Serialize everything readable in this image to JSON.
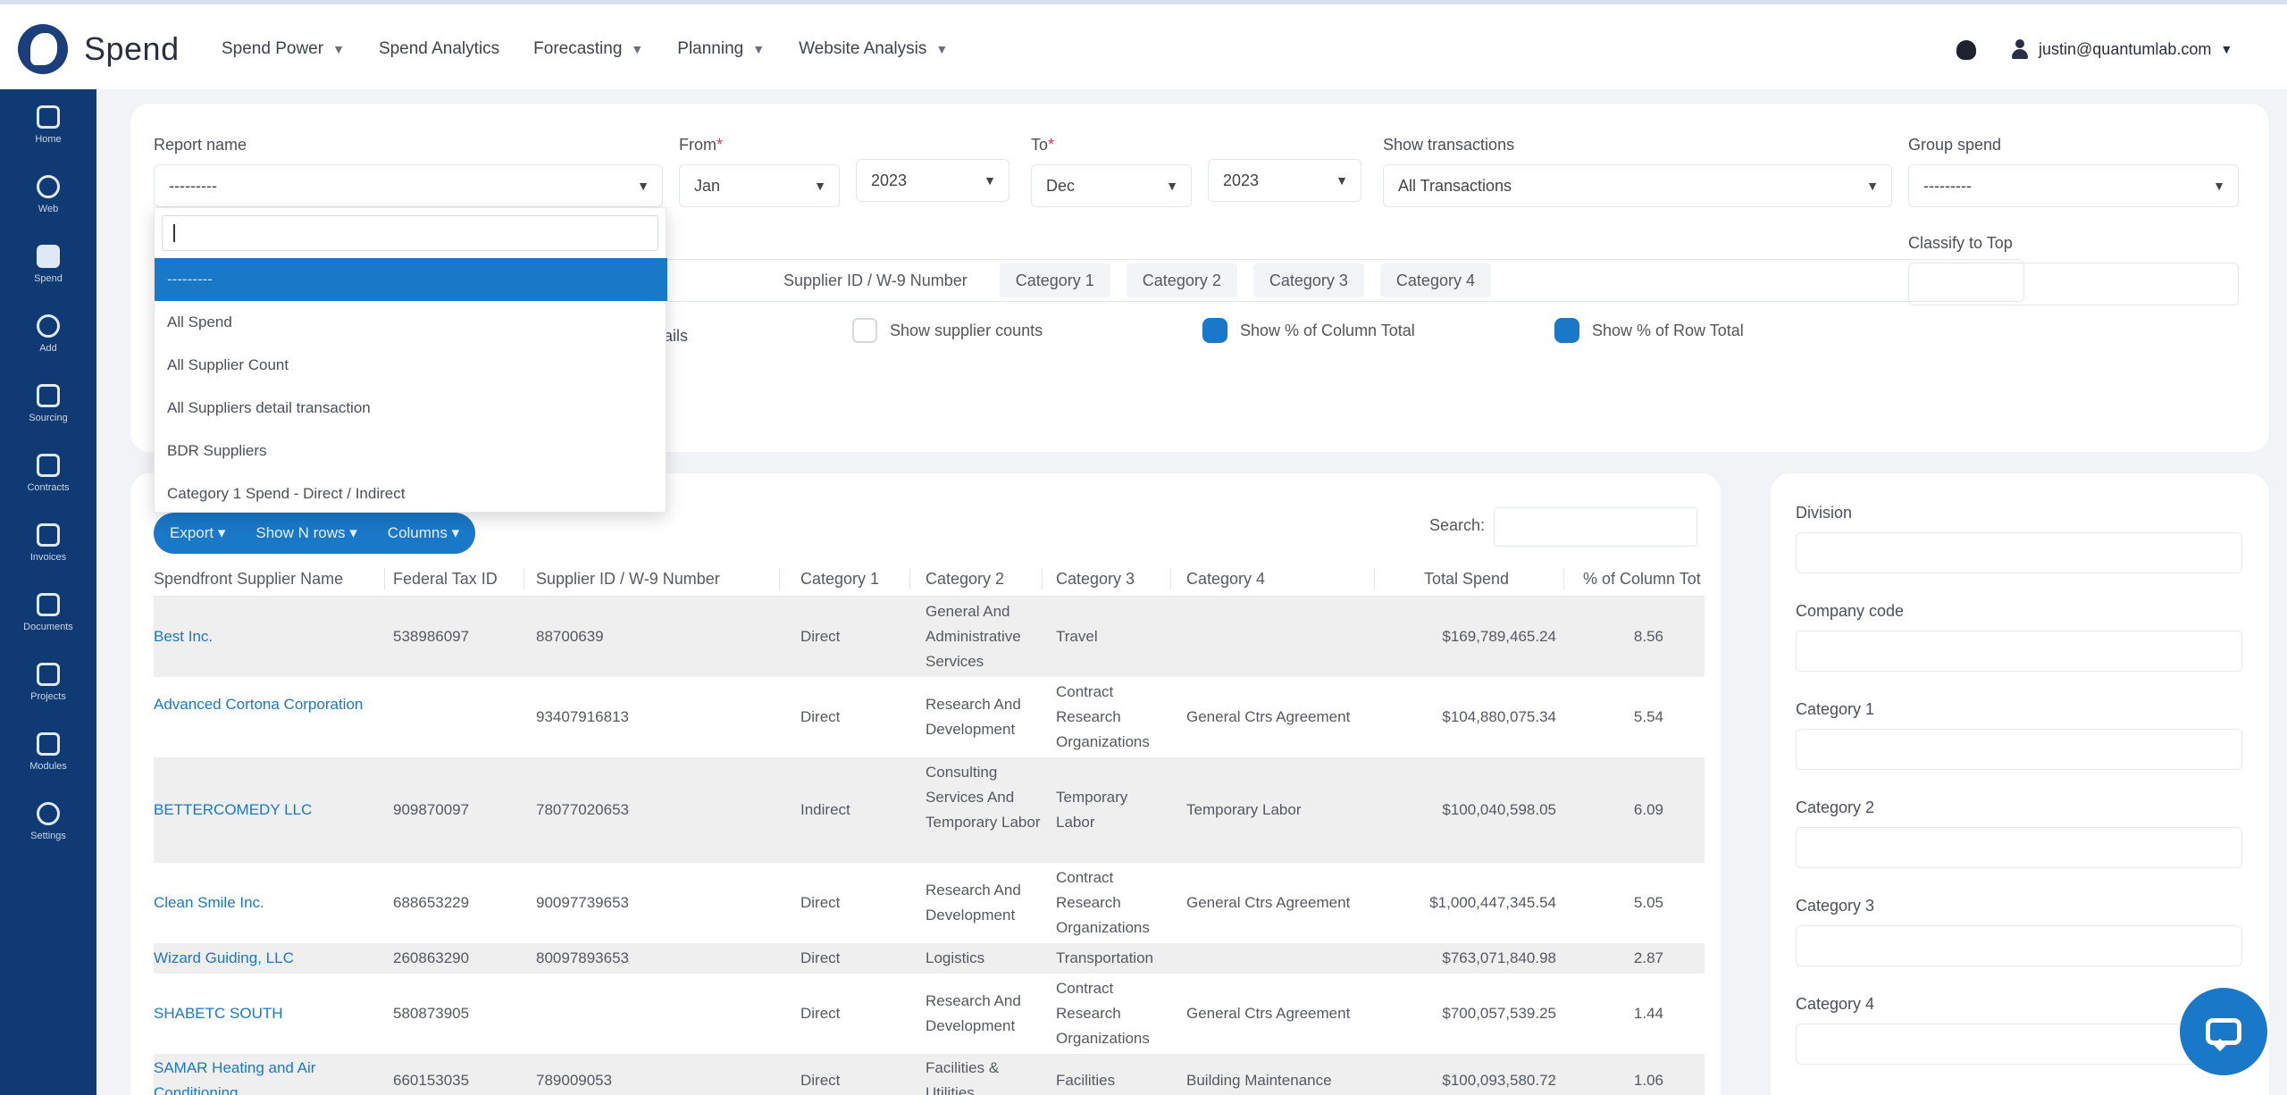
{
  "app": {
    "brand_name": "Spend"
  },
  "nav": {
    "items": [
      {
        "label": "Spend Power",
        "caret": true
      },
      {
        "label": "Spend Analytics",
        "caret": false
      },
      {
        "label": "Forecasting",
        "caret": true
      },
      {
        "label": "Planning",
        "caret": true
      },
      {
        "label": "Website Analysis",
        "caret": true
      }
    ],
    "user_email": "justin@quantumlab.com"
  },
  "sidebar": {
    "items": [
      {
        "label": "Home",
        "icon": "home-icon"
      },
      {
        "label": "Web",
        "icon": "globe-icon"
      },
      {
        "label": "Spend",
        "icon": "spend-icon",
        "active": true
      },
      {
        "label": "Add",
        "icon": "add-icon"
      },
      {
        "label": "Sourcing",
        "icon": "document-icon"
      },
      {
        "label": "Contracts",
        "icon": "contract-icon"
      },
      {
        "label": "Invoices",
        "icon": "invoice-icon"
      },
      {
        "label": "Documents",
        "icon": "folder-icon"
      },
      {
        "label": "Projects",
        "icon": "project-icon"
      },
      {
        "label": "Modules",
        "icon": "module-icon"
      },
      {
        "label": "Settings",
        "icon": "settings-icon"
      }
    ]
  },
  "filters": {
    "report_label": "Report name",
    "report_value": "---------",
    "from_label": "From",
    "from_month": "Jan",
    "from_year": "2023",
    "to_label": "To",
    "to_month": "Dec",
    "to_year": "2023",
    "show_transactions_label": "Show transactions",
    "show_transactions_value": "All Transactions",
    "group_spend_label": "Group spend",
    "group_spend_value": "---------",
    "classify_label": "Classify to Top",
    "column_chips": [
      "Supplier ID / W-9 Number",
      "Category 1",
      "Category 2",
      "Category 3",
      "Category 4"
    ],
    "options": [
      {
        "label": "Show supplier counts",
        "checked": false
      },
      {
        "label": "Show % of Column Total",
        "checked": true
      },
      {
        "label": "Show % of Row Total",
        "checked": true
      }
    ],
    "partial_option_label": "tails"
  },
  "dropdown": {
    "options": [
      {
        "label": "---------",
        "selected": true
      },
      {
        "label": "All Spend",
        "selected": false
      },
      {
        "label": "All Supplier Count",
        "selected": false
      },
      {
        "label": "All Suppliers detail transaction",
        "selected": false
      },
      {
        "label": "BDR Suppliers",
        "selected": false
      },
      {
        "label": "Category 1 Spend - Direct / Indirect",
        "selected": false
      }
    ]
  },
  "table": {
    "buttons": [
      "Export ▾",
      "Show N rows ▾",
      "Columns ▾"
    ],
    "search_label": "Search:",
    "columns": [
      "Spendfront Supplier Name",
      "Federal Tax ID",
      "Supplier ID / W-9 Number",
      "Category 1",
      "Category 2",
      "Category 3",
      "Category 4",
      "Total Spend",
      "% of Column Tot"
    ],
    "rows": [
      {
        "name": "Best Inc.",
        "tax_id": "538986097",
        "supplier_id": "88700639",
        "cat1": "Direct",
        "cat2": "General And Administrative Services",
        "cat3": "Travel",
        "cat4": "",
        "total": "$169,789,465.24",
        "pct": "8.56"
      },
      {
        "name": "Advanced Cortona Corporation",
        "tax_id": "",
        "supplier_id": "93407916813",
        "cat1": "Direct",
        "cat2": "Research And Development",
        "cat3": "Contract Research Organizations",
        "cat4": "General Ctrs Agreement",
        "total": "$104,880,075.34",
        "pct": "5.54"
      },
      {
        "name": "BETTERCOMEDY LLC",
        "tax_id": "909870097",
        "supplier_id": "78077020653",
        "cat1": "Indirect",
        "cat2": "Consulting Services And Temporary Labor",
        "cat3": "Temporary Labor",
        "cat4": "Temporary Labor",
        "total": "$100,040,598.05",
        "pct": "6.09"
      },
      {
        "name": "Clean Smile Inc.",
        "tax_id": "688653229",
        "supplier_id": "90097739653",
        "cat1": "Direct",
        "cat2": "Research And Development",
        "cat3": "Contract Research Organizations",
        "cat4": "General Ctrs Agreement",
        "total": "$1,000,447,345.54",
        "pct": "5.05"
      },
      {
        "name": "Wizard Guiding, LLC",
        "tax_id": "260863290",
        "supplier_id": "80097893653",
        "cat1": "Direct",
        "cat2": "Logistics",
        "cat3": "Transportation",
        "cat4": "",
        "total": "$763,071,840.98",
        "pct": "2.87"
      },
      {
        "name": "SHABETC SOUTH",
        "tax_id": "580873905",
        "supplier_id": "",
        "cat1": "Direct",
        "cat2": "Research And Development",
        "cat3": "Contract Research Organizations",
        "cat4": "General Ctrs Agreement",
        "total": "$700,057,539.25",
        "pct": "1.44"
      },
      {
        "name": "SAMAR Heating and Air Conditioning",
        "tax_id": "660153035",
        "supplier_id": "789009053",
        "cat1": "Direct",
        "cat2": "Facilities & Utilities",
        "cat3": "Facilities",
        "cat4": "Building Maintenance",
        "total": "$100,093,580.72",
        "pct": "1.06"
      }
    ]
  },
  "right_panel": {
    "fields": [
      "Division",
      "Company code",
      "Category 1",
      "Category 2",
      "Category 3",
      "Category 4"
    ]
  },
  "colors": {
    "sidebar": "#0f3a73",
    "accent": "#1a78c8",
    "link": "#1a78c8"
  }
}
